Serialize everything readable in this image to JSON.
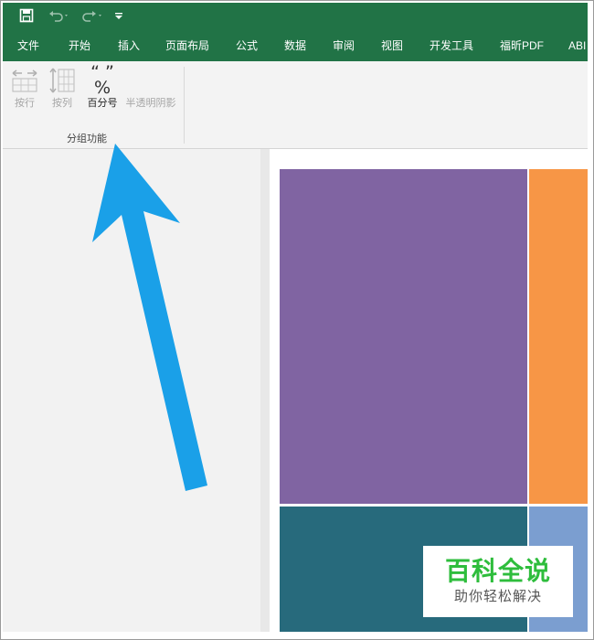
{
  "quick_access": {
    "save": "save-icon",
    "undo": "undo-icon",
    "redo": "redo-icon",
    "customize": "customize-icon"
  },
  "tabs": [
    "文件",
    "开始",
    "插入",
    "页面布局",
    "公式",
    "数据",
    "审阅",
    "视图",
    "开发工具",
    "福昕PDF",
    "ABI"
  ],
  "ribbon": {
    "by_row": "按行",
    "by_column": "按列",
    "percent_symbol_icon_text": "“ ” %",
    "percent": "百分号",
    "translucent_shadow": "半透明阴影",
    "group_label": "分组功能"
  },
  "colors": {
    "ribbon_green": "#217346",
    "tile_purple": "#8064a2",
    "tile_orange": "#f79646",
    "tile_teal": "#276a7c",
    "tile_blue": "#7b9ed0",
    "arrow": "#1aa0e8"
  },
  "watermark": {
    "main": "百科全说",
    "sub": "助你轻松解决"
  }
}
